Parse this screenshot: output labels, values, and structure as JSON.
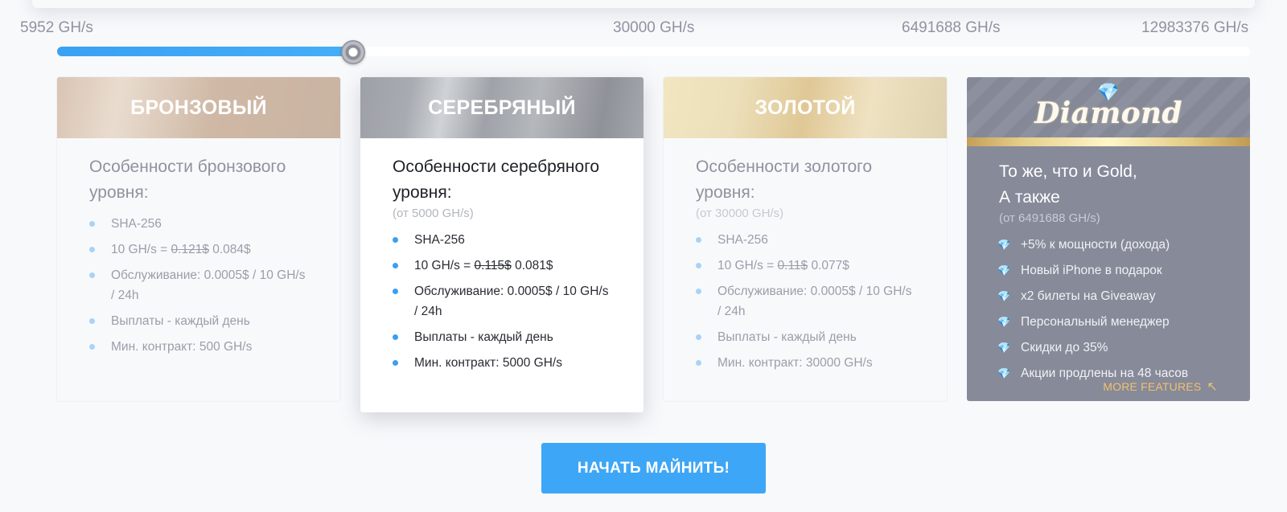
{
  "slider": {
    "labels": [
      "5952 GH/s",
      "30000 GH/s",
      "6491688 GH/s",
      "12983376 GH/s"
    ],
    "fill_fraction": 0.248
  },
  "plans": {
    "bronze": {
      "title": "БРОНЗОВЫЙ",
      "heading_line1": "Особенности бронзового",
      "heading_line2": "уровня:",
      "features": {
        "f1": "SHA-256",
        "price_prefix": "10 GH/s = ",
        "price_old": "0.121$",
        "price_new": " 0.084$",
        "f3": "Обслуживание: 0.0005$ / 10 GH/s / 24h",
        "f4": "Выплаты - каждый день",
        "f5": "Мин. контракт: 500 GH/s"
      }
    },
    "silver": {
      "title": "СЕРЕБРЯНЫЙ",
      "heading_line1": "Особенности серебряного",
      "heading_line2": "уровня:",
      "subtitle": "(от 5000 GH/s)",
      "features": {
        "f1": "SHA-256",
        "price_prefix": "10 GH/s = ",
        "price_old": "0.115$",
        "price_new": " 0.081$",
        "f3": "Обслуживание: 0.0005$ / 10 GH/s / 24h",
        "f4": "Выплаты - каждый день",
        "f5": "Мин. контракт: 5000 GH/s"
      }
    },
    "gold": {
      "title": "ЗОЛОТОЙ",
      "heading_line1": "Особенности золотого",
      "heading_line2": "уровня:",
      "subtitle": "(от 30000 GH/s)",
      "features": {
        "f1": "SHA-256",
        "price_prefix": "10 GH/s = ",
        "price_old": "0.11$",
        "price_new": " 0.077$",
        "f3": "Обслуживание: 0.0005$ / 10 GH/s / 24h",
        "f4": "Выплаты - каждый день",
        "f5": "Мин. контракт: 30000 GH/s"
      }
    },
    "diamond": {
      "logo": "Diamond",
      "heading_line1": "То же, что и Gold,",
      "heading_line2": "А также",
      "subtitle": "(от 6491688 GH/s)",
      "features": [
        "+5% к мощности (дохода)",
        "Новый iPhone в подарок",
        "x2 билеты на Giveaway",
        "Персональный менеджер",
        "Скидки до 35%",
        "Акции продлены на 48 часов"
      ],
      "more_label": "MORE FEATURES"
    }
  },
  "cta_label": "НАЧАТЬ МАЙНИТЬ!",
  "colors": {
    "accent": "#3ea6f6",
    "diamond_bg": "#868a99",
    "more_features": "#f1c06e"
  }
}
